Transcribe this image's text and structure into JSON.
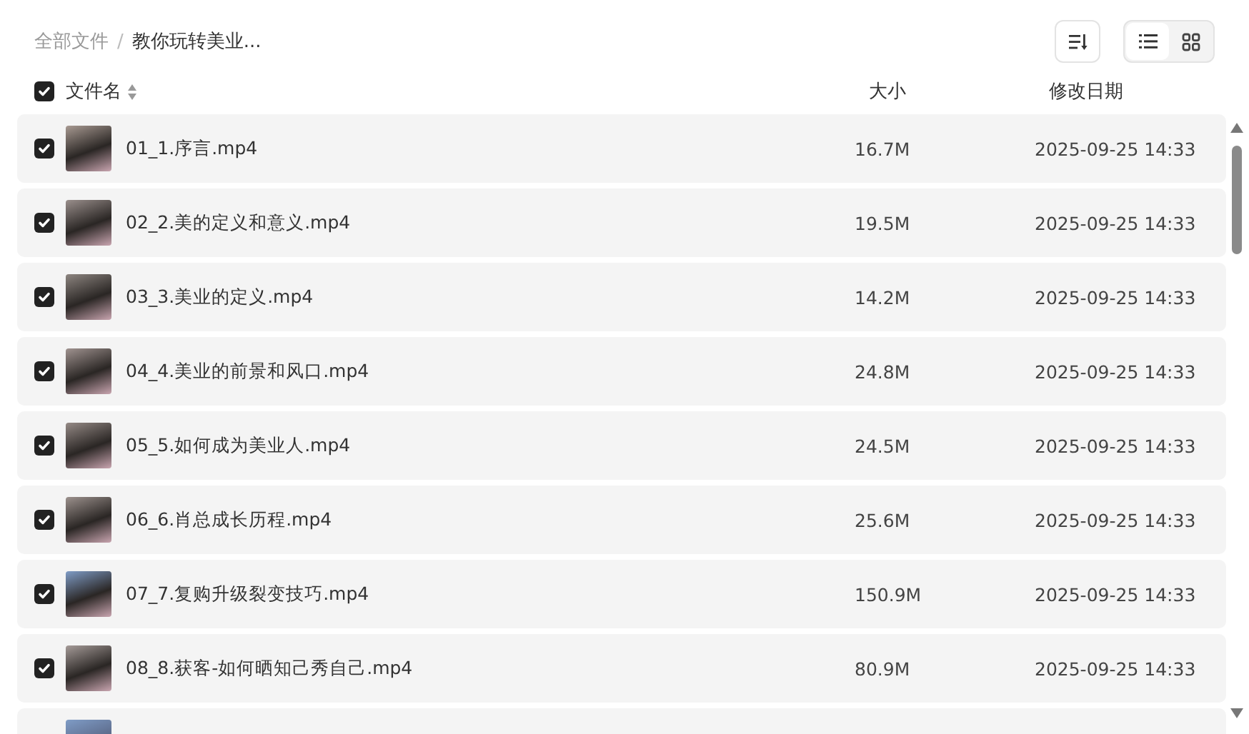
{
  "breadcrumb": [
    {
      "label": "全部文件",
      "current": false
    },
    {
      "label": "教你玩转美业...",
      "current": true
    }
  ],
  "breadcrumb_separator": "/",
  "view_modes": [
    {
      "kind": "list",
      "selected": true
    },
    {
      "kind": "grid",
      "selected": false
    }
  ],
  "header": {
    "checked": true,
    "columns": [
      "文件名",
      "大小",
      "修改日期"
    ]
  },
  "rows": [
    {
      "name": "01_1.序言.mp4",
      "size": "16.7M",
      "modified": "2025-09-25 14:33",
      "checked": true
    },
    {
      "name": "02_2.美的定义和意义.mp4",
      "size": "19.5M",
      "modified": "2025-09-25 14:33",
      "checked": true
    },
    {
      "name": "03_3.美业的定义.mp4",
      "size": "14.2M",
      "modified": "2025-09-25 14:33",
      "checked": true
    },
    {
      "name": "04_4.美业的前景和风口.mp4",
      "size": "24.8M",
      "modified": "2025-09-25 14:33",
      "checked": true
    },
    {
      "name": "05_5.如何成为美业人.mp4",
      "size": "24.5M",
      "modified": "2025-09-25 14:33",
      "checked": true
    },
    {
      "name": "06_6.肖总成长历程.mp4",
      "size": "25.6M",
      "modified": "2025-09-25 14:33",
      "checked": true
    },
    {
      "name": "07_7.复购升级裂变技巧.mp4",
      "size": "150.9M",
      "modified": "2025-09-25 14:33",
      "checked": true
    },
    {
      "name": "08_8.获客-如何晒知己秀自己.mp4",
      "size": "80.9M",
      "modified": "2025-09-25 14:33",
      "checked": true
    }
  ]
}
